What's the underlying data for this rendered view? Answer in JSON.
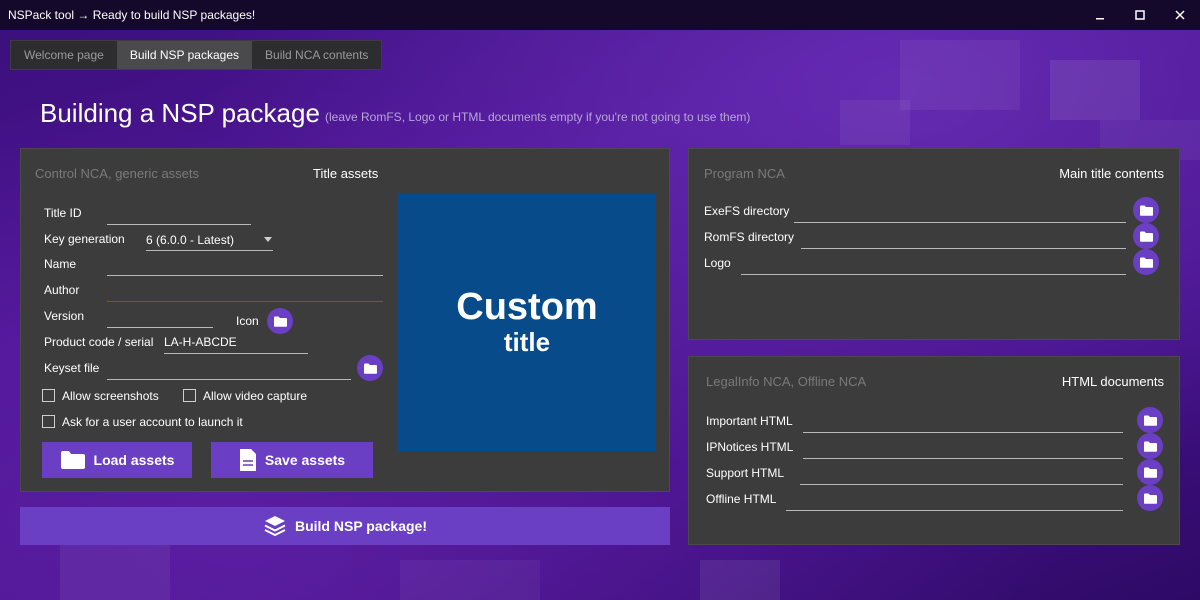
{
  "window": {
    "title": "NSPack tool → Ready to build NSP packages!"
  },
  "tabs": [
    {
      "label": "Welcome page"
    },
    {
      "label": "Build NSP packages"
    },
    {
      "label": "Build NCA contents"
    }
  ],
  "heading": "Building a NSP package",
  "subheading": "(leave RomFS, Logo or HTML documents empty if you're not going to use them)",
  "control_panel": {
    "title_left": "Control NCA, generic assets",
    "title_right": "Title assets",
    "title_id_label": "Title ID",
    "key_generation_label": "Key generation",
    "key_generation_value": "6 (6.0.0 - Latest)",
    "name_label": "Name",
    "author_label": "Author",
    "version_label": "Version",
    "icon_label": "Icon",
    "product_code_label": "Product code / serial",
    "product_code_value": "LA-H-ABCDE",
    "keyset_label": "Keyset file",
    "allow_screenshots_label": "Allow screenshots",
    "allow_video_label": "Allow video capture",
    "ask_account_label": "Ask for a user account to launch it",
    "load_assets_label": "Load assets",
    "save_assets_label": "Save assets",
    "preview_line1": "Custom",
    "preview_line2": "title"
  },
  "build_button_label": "Build NSP package!",
  "program_panel": {
    "title_left": "Program NCA",
    "title_right": "Main title contents",
    "exefs_label": "ExeFS directory",
    "romfs_label": "RomFS directory",
    "logo_label": "Logo"
  },
  "html_panel": {
    "title_left": "LegalInfo NCA, Offline NCA",
    "title_right": "HTML documents",
    "important_label": "Important HTML",
    "ipnotices_label": "IPNotices HTML",
    "support_label": "Support HTML",
    "offline_label": "Offline HTML"
  },
  "colors": {
    "accent": "#6a3fc4",
    "panel": "#3c3c3c",
    "preview_bg": "#074b8a",
    "titlebar": "#14092a"
  },
  "icons": {
    "folder": "folder-icon",
    "load": "folder-open-icon",
    "save": "file-document-icon",
    "build": "stack-layers-icon"
  }
}
